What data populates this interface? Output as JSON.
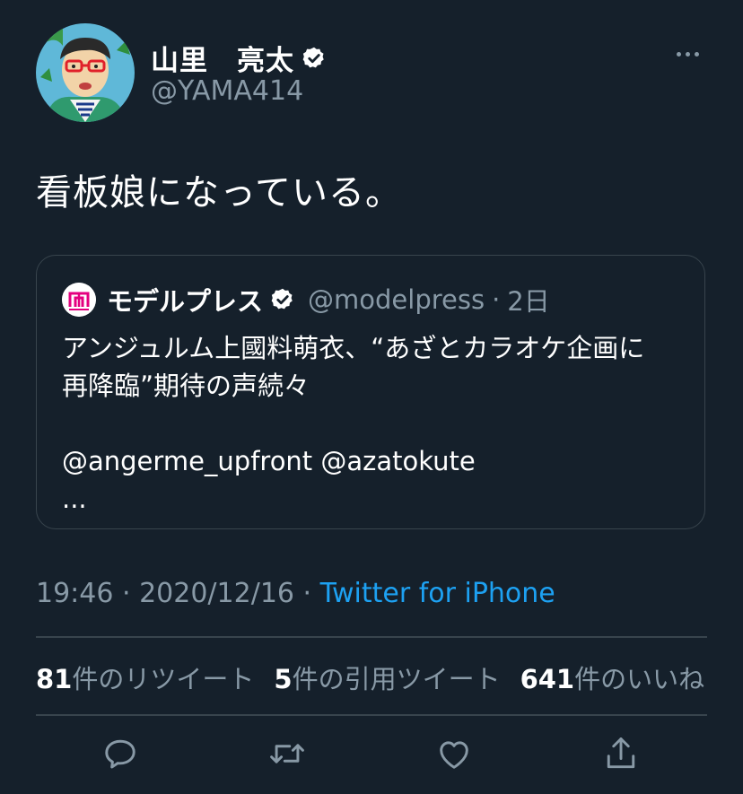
{
  "author": {
    "display_name": "山里　亮太",
    "handle": "@YAMA414",
    "verified": true,
    "avatar_icon": "illustrated-portrait-avatar"
  },
  "tweet": {
    "text": "看板娘になっている。",
    "time": "19:46",
    "separator1": " · ",
    "date": "2020/12/16",
    "separator2": " · ",
    "source": "Twitter for iPhone"
  },
  "quoted_tweet": {
    "display_name": "モデルプレス",
    "handle": "@modelpress",
    "separator": "·",
    "time": "2日",
    "logo_icon": "modelpress-logo",
    "text_lines": [
      "アンジュルム上國料萌衣、“あざとカラオケ企画に",
      "再降臨”期待の声続々",
      "",
      "@angerme_upfront @azatokute",
      "..."
    ]
  },
  "stats": {
    "retweets": {
      "count": "81",
      "label": "件のリツイート"
    },
    "quotes": {
      "count": "5",
      "label": "件の引用ツイート"
    },
    "likes": {
      "count": "641",
      "label": "件のいいね"
    }
  },
  "actions": {
    "reply_icon": "reply-icon",
    "retweet_icon": "retweet-icon",
    "like_icon": "like-icon",
    "share_icon": "share-icon"
  },
  "colors": {
    "background": "#15202b",
    "secondary_text": "#8899a6",
    "accent": "#1da1f2",
    "border": "#38444d"
  }
}
